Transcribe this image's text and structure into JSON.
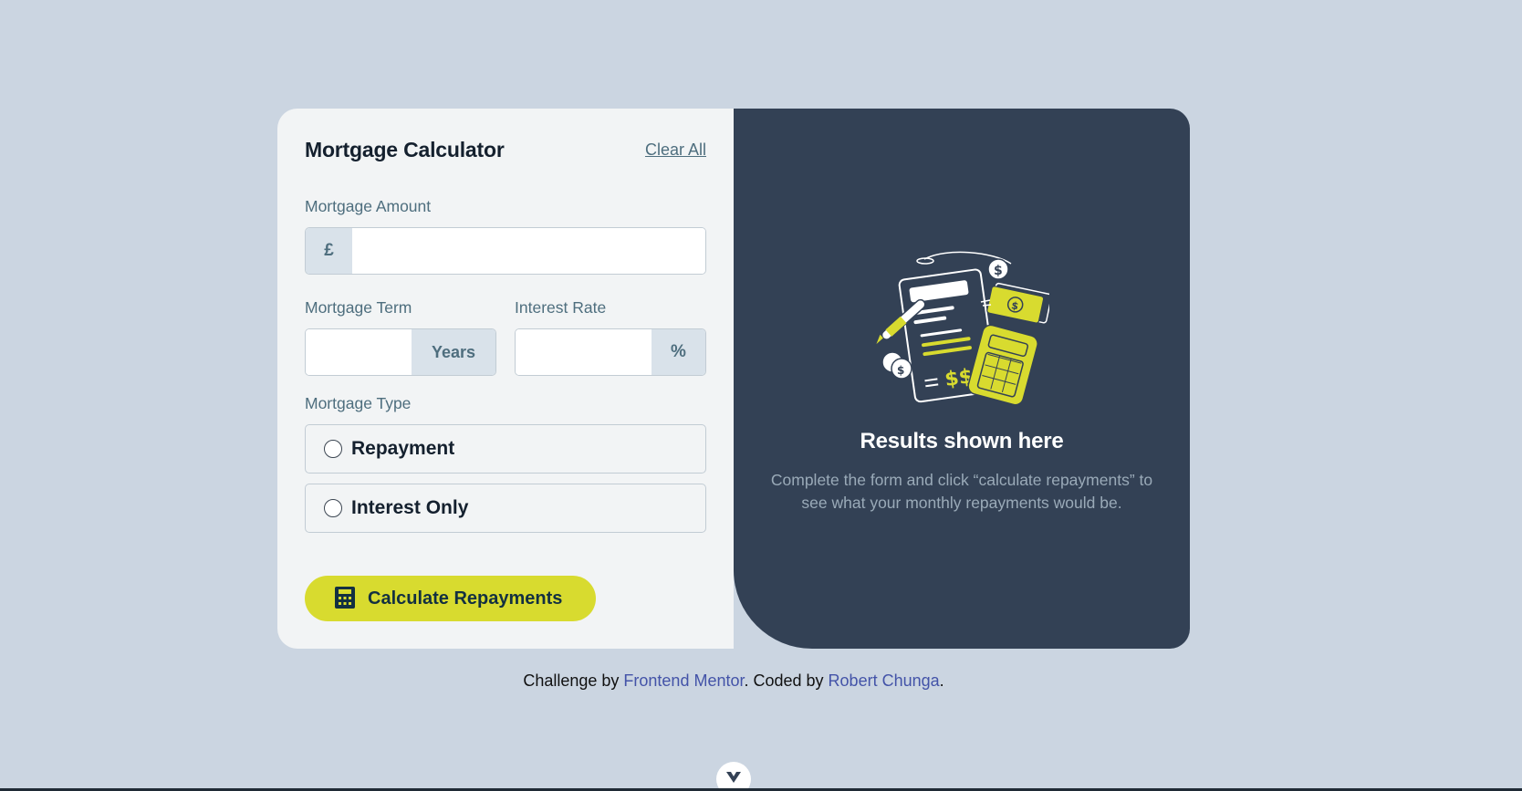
{
  "form": {
    "title": "Mortgage Calculator",
    "clear_all": "Clear All",
    "amount": {
      "label": "Mortgage Amount",
      "prefix": "£",
      "value": ""
    },
    "term": {
      "label": "Mortgage Term",
      "suffix": "Years",
      "value": ""
    },
    "rate": {
      "label": "Interest Rate",
      "suffix": "%",
      "value": ""
    },
    "type": {
      "label": "Mortgage Type",
      "options": [
        {
          "label": "Repayment",
          "selected": false
        },
        {
          "label": "Interest Only",
          "selected": false
        }
      ]
    },
    "submit_label": "Calculate Repayments"
  },
  "results": {
    "title": "Results shown here",
    "description": "Complete the form and click “calculate repayments” to see what your monthly repayments would be."
  },
  "footer": {
    "prefix": "Challenge by ",
    "link1": "Frontend Mentor",
    "middle": ". Coded by ",
    "link2": "Robert Chunga",
    "suffix": "."
  },
  "colors": {
    "background": "#cbd5e1",
    "accent_lime": "#d8db2f",
    "results_bg": "#334155",
    "link": "#4353a8"
  },
  "icons": [
    "calculator-icon",
    "illustration-empty",
    "chevron-down-icon"
  ]
}
